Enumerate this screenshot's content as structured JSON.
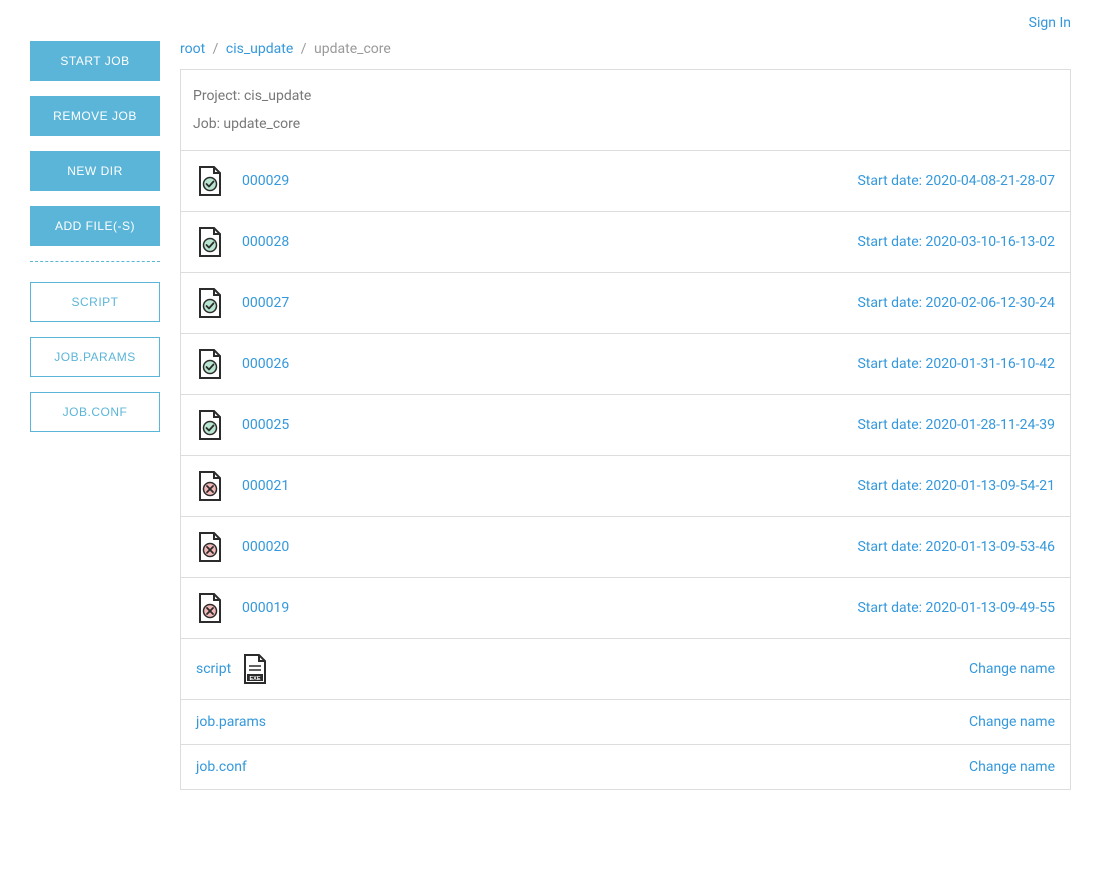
{
  "header": {
    "sign_in": "Sign In"
  },
  "sidebar": {
    "start_job": "START JOB",
    "remove_job": "REMOVE JOB",
    "new_dir": "NEW DIR",
    "add_files": "ADD FILE(-S)",
    "script": "SCRIPT",
    "job_params": "JOB.PARAMS",
    "job_conf": "JOB.CONF"
  },
  "breadcrumb": {
    "root": "root",
    "project": "cis_update",
    "current": "update_core"
  },
  "panel": {
    "project_label": "Project: cis_update",
    "job_label": "Job: update_core"
  },
  "runs": [
    {
      "id": "000029",
      "status": "success",
      "date": "Start date: 2020-04-08-21-28-07"
    },
    {
      "id": "000028",
      "status": "success",
      "date": "Start date: 2020-03-10-16-13-02"
    },
    {
      "id": "000027",
      "status": "success",
      "date": "Start date: 2020-02-06-12-30-24"
    },
    {
      "id": "000026",
      "status": "success",
      "date": "Start date: 2020-01-31-16-10-42"
    },
    {
      "id": "000025",
      "status": "success",
      "date": "Start date: 2020-01-28-11-24-39"
    },
    {
      "id": "000021",
      "status": "failed",
      "date": "Start date: 2020-01-13-09-54-21"
    },
    {
      "id": "000020",
      "status": "failed",
      "date": "Start date: 2020-01-13-09-53-46"
    },
    {
      "id": "000019",
      "status": "failed",
      "date": "Start date: 2020-01-13-09-49-55"
    }
  ],
  "files": [
    {
      "name": "script",
      "type": "exe",
      "action": "Change name"
    },
    {
      "name": "job.params",
      "type": "plain",
      "action": "Change name"
    },
    {
      "name": "job.conf",
      "type": "plain",
      "action": "Change name"
    }
  ]
}
